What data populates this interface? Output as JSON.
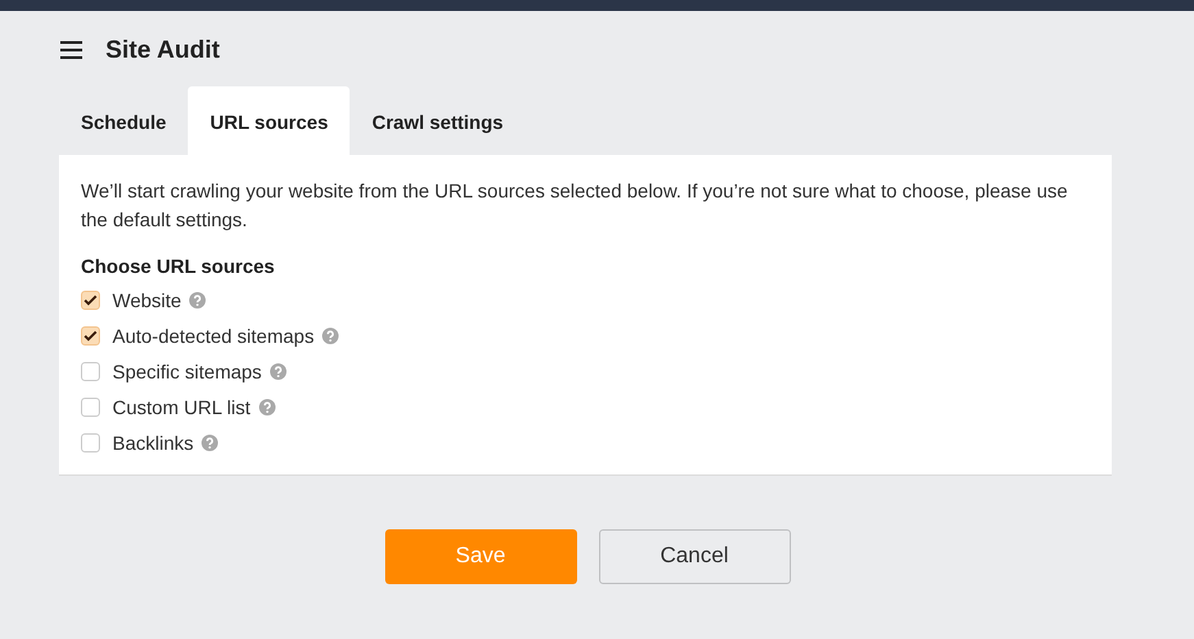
{
  "title": "Site Audit",
  "tabs": [
    {
      "label": "Schedule",
      "selected": false
    },
    {
      "label": "URL sources",
      "selected": true
    },
    {
      "label": "Crawl settings",
      "selected": false
    }
  ],
  "intro": "We’ll start crawling your website from the URL sources selected below. If you’re not sure what to choose, please use the default settings.",
  "section_title": "Choose URL sources",
  "sources": [
    {
      "label": "Website",
      "checked": true
    },
    {
      "label": "Auto-detected sitemaps",
      "checked": true
    },
    {
      "label": "Specific sitemaps",
      "checked": false
    },
    {
      "label": "Custom URL list",
      "checked": false
    },
    {
      "label": "Backlinks",
      "checked": false
    }
  ],
  "buttons": {
    "save": "Save",
    "cancel": "Cancel"
  }
}
